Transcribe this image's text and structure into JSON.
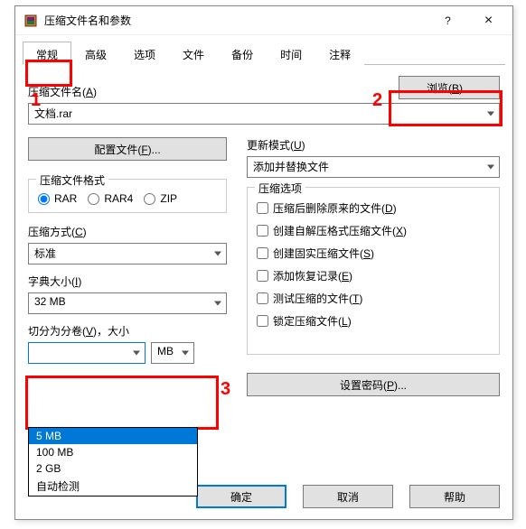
{
  "window": {
    "title": "压缩文件名和参数",
    "help": "?",
    "close": "×"
  },
  "tabs": [
    "常规",
    "高级",
    "选项",
    "文件",
    "备份",
    "时间",
    "注释"
  ],
  "active_tab_index": 0,
  "archive": {
    "label_prefix": "压缩文件名(",
    "label_key": "A",
    "label_suffix": ")",
    "value": "文档.rar",
    "browse_prefix": "浏览(",
    "browse_key": "B",
    "browse_suffix": ")..."
  },
  "profile_btn_prefix": "配置文件(",
  "profile_btn_key": "F",
  "profile_btn_suffix": ")...",
  "update_mode": {
    "label_prefix": "更新模式(",
    "label_key": "U",
    "label_suffix": ")",
    "value": "添加并替换文件"
  },
  "format": {
    "title": "压缩文件格式",
    "r1": "RAR",
    "r2": "RAR4",
    "r3": "ZIP",
    "selected": "RAR"
  },
  "method": {
    "label_prefix": "压缩方式(",
    "label_key": "C",
    "label_suffix": ")",
    "value": "标准"
  },
  "dict": {
    "label_prefix": "字典大小(",
    "label_key": "I",
    "label_suffix": ")",
    "value": "32 MB"
  },
  "split": {
    "label_prefix": "切分为分卷(",
    "label_key": "V",
    "label_suffix": ")，大小",
    "value": "",
    "unit": "MB",
    "options": [
      "5 MB",
      "100 MB",
      "2 GB",
      "自动检测"
    ],
    "highlighted": "5 MB"
  },
  "opts": {
    "title": "压缩选项",
    "items": [
      {
        "text_prefix": "压缩后删除原来的文件(",
        "key": "D",
        "suffix": ")"
      },
      {
        "text_prefix": "创建自解压格式压缩文件(",
        "key": "X",
        "suffix": ")"
      },
      {
        "text_prefix": "创建固实压缩文件(",
        "key": "S",
        "suffix": ")"
      },
      {
        "text_prefix": "添加恢复记录(",
        "key": "E",
        "suffix": ")"
      },
      {
        "text_prefix": "测试压缩的文件(",
        "key": "T",
        "suffix": ")"
      },
      {
        "text_prefix": "锁定压缩文件(",
        "key": "L",
        "suffix": ")"
      }
    ]
  },
  "pwd_btn_prefix": "设置密码(",
  "pwd_btn_key": "P",
  "pwd_btn_suffix": ")...",
  "buttons": {
    "ok": "确定",
    "cancel": "取消",
    "help": "帮助"
  },
  "annotations": {
    "one": "1",
    "two": "2",
    "three": "3"
  }
}
